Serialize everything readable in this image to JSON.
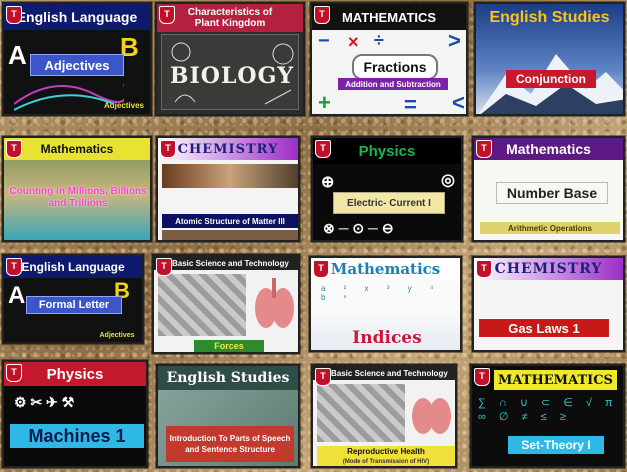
{
  "tiles": [
    {
      "subject": "English Language",
      "topic": "Adjectives",
      "extra": "Adjectives"
    },
    {
      "subject": "Characteristics of Plant Kingdom",
      "topic": "BIOLOGY"
    },
    {
      "subject": "MATHEMATICS",
      "topic": "Fractions",
      "extra": "Addition and Subtraction"
    },
    {
      "subject": "English Studies",
      "topic": "Conjunction"
    },
    {
      "subject": "Mathematics",
      "topic": "Counting in Millions, Billions and Trillions"
    },
    {
      "subject": "CHEMISTRY",
      "topic": "Atomic Structure of Matter III"
    },
    {
      "subject": "Physics",
      "topic": "Electric- Current I"
    },
    {
      "subject": "Mathematics",
      "topic": "Number Base",
      "extra": "Arithmetic Operations"
    },
    {
      "subject": "English Language",
      "topic": "Formal Letter",
      "extra": "Adjectives"
    },
    {
      "subject": "Basic Science and Technology",
      "topic": "Forces"
    },
    {
      "subject": "Mathematics",
      "topic": "Indices"
    },
    {
      "subject": "CHEMISTRY",
      "topic": "Gas Laws 1"
    },
    {
      "subject": "Physics",
      "topic": "Machines 1"
    },
    {
      "subject": "English Studies",
      "topic": "Introduction To Parts of Speech and Sentence Structure"
    },
    {
      "subject": "Basic Science and Technology",
      "topic": "Reproductive Health",
      "extra": "(Mode of Transmission of HIV)"
    },
    {
      "subject": "MATHEMATICS",
      "topic": "Set-Theory I"
    }
  ]
}
